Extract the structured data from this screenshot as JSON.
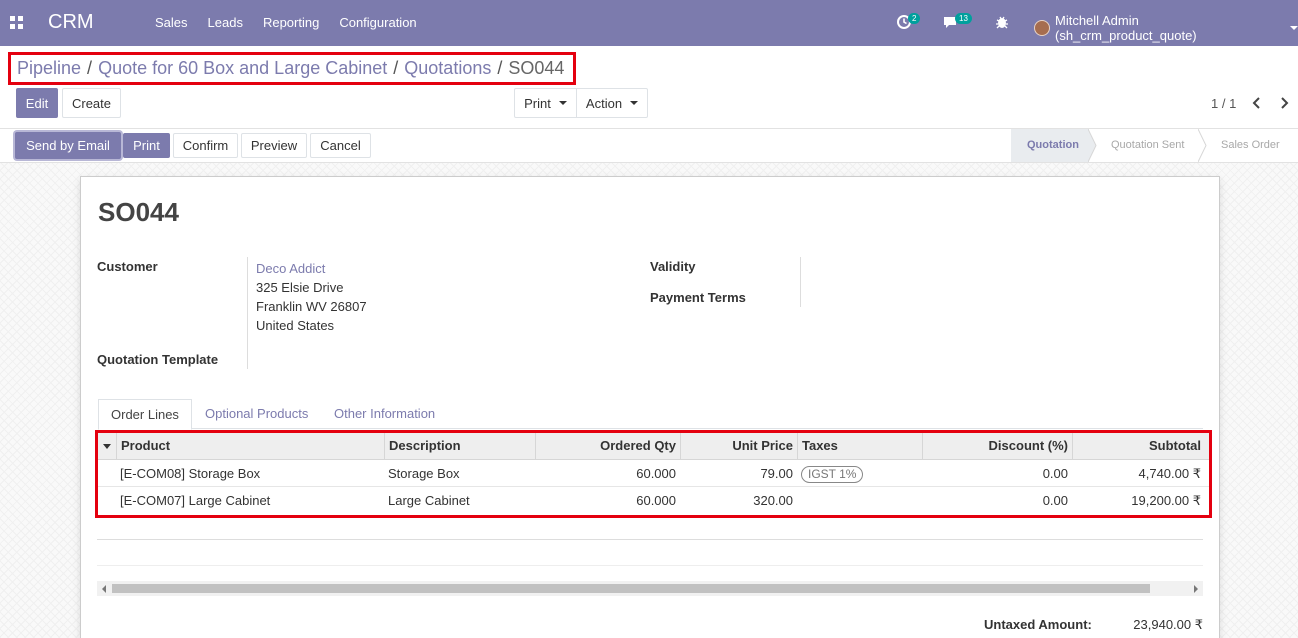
{
  "navbar": {
    "brand": "CRM",
    "menu": [
      "Sales",
      "Leads",
      "Reporting",
      "Configuration"
    ],
    "activity_count": "2",
    "message_count": "13",
    "user_name": "Mitchell Admin (sh_crm_product_quote)"
  },
  "breadcrumb": {
    "items": [
      "Pipeline",
      "Quote for 60 Box and Large Cabinet",
      "Quotations"
    ],
    "current": "SO044"
  },
  "control": {
    "edit_label": "Edit",
    "create_label": "Create",
    "print_label": "Print",
    "action_label": "Action",
    "pager": "1 / 1"
  },
  "header_buttons": {
    "send_email": "Send by Email",
    "print": "Print",
    "confirm": "Confirm",
    "preview": "Preview",
    "cancel": "Cancel"
  },
  "statusbar": {
    "stages": [
      "Quotation",
      "Quotation Sent",
      "Sales Order"
    ],
    "active": "Quotation"
  },
  "form": {
    "name": "SO044",
    "customer_label": "Customer",
    "customer_name": "Deco Addict",
    "customer_address": [
      "325 Elsie Drive",
      "Franklin WV 26807",
      "United States"
    ],
    "quotation_template_label": "Quotation Template",
    "validity_label": "Validity",
    "payment_terms_label": "Payment Terms"
  },
  "tabs": [
    "Order Lines",
    "Optional Products",
    "Other Information"
  ],
  "order_lines": {
    "columns": [
      "Product",
      "Description",
      "Ordered Qty",
      "Unit Price",
      "Taxes",
      "Discount (%)",
      "Subtotal"
    ],
    "rows": [
      {
        "product": "[E-COM08] Storage Box",
        "description": "Storage Box",
        "qty": "60.000",
        "unit_price": "79.00",
        "taxes": "IGST 1%",
        "discount": "0.00",
        "subtotal": "4,740.00 ₹"
      },
      {
        "product": "[E-COM07] Large Cabinet",
        "description": "Large Cabinet",
        "qty": "60.000",
        "unit_price": "320.00",
        "taxes": "",
        "discount": "0.00",
        "subtotal": "19,200.00 ₹"
      }
    ]
  },
  "totals": {
    "untaxed_label": "Untaxed Amount:",
    "untaxed_value": "23,940.00 ₹"
  }
}
